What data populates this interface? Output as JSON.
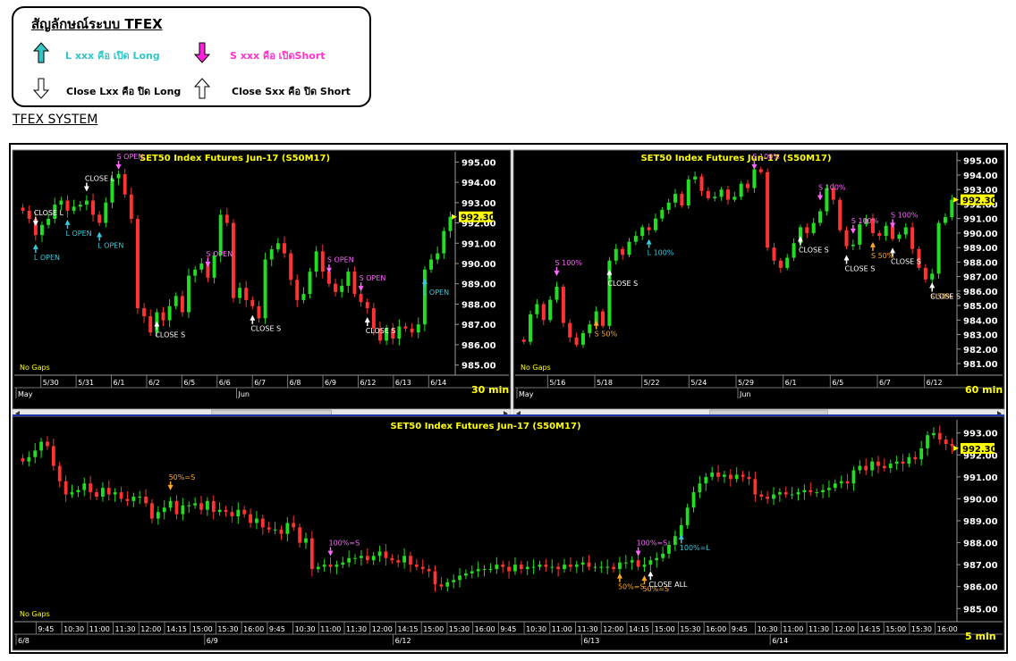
{
  "legend": {
    "title": "สัญลักษณ์ระบบ TFEX",
    "open_long": "L xxx คือ เปิด Long",
    "open_short": "S xxx คือ เปิดShort",
    "close_long": "Close Lxx คือ ปิด Long",
    "close_short": "Close Sxx คือ ปิด Short",
    "colors": {
      "long": "#33c6c6",
      "short": "#ff33cc",
      "close": "#ffffff"
    }
  },
  "system_title": "TFEX SYSTEM",
  "colors": {
    "up": "#22dd22",
    "down": "#ff3333",
    "bg": "#000000",
    "price_box": "#ffff00",
    "title": "#ffff00",
    "signal_cyan": "#33ccdd",
    "signal_magenta": "#ff66ff",
    "signal_orange": "#ffaa22"
  },
  "chart_data": [
    {
      "type": "candlestick",
      "title": "SET50  Index  Futures  Jun-17  (S50M17)",
      "timeframe": "30  min",
      "no_gaps": "No  Gaps",
      "last_price": "992.30",
      "y_ticks": [
        "995.00",
        "994.00",
        "993.00",
        "992.00",
        "991.00",
        "990.00",
        "989.00",
        "988.00",
        "987.00",
        "986.00",
        "985.00"
      ],
      "ylim": [
        984.5,
        995.5
      ],
      "x_ticks": [
        "5/30",
        "5/31",
        "6/1",
        "6/2",
        "6/5",
        "6/6",
        "6/7",
        "6/8",
        "6/9",
        "6/12",
        "6/13",
        "6/14"
      ],
      "months": [
        "May",
        "Jun"
      ],
      "closes": [
        992.6,
        992.2,
        991.4,
        991.9,
        992.2,
        992.9,
        993.1,
        992.6,
        992.8,
        992.9,
        993.1,
        992.4,
        992.0,
        993.0,
        994.2,
        994.4,
        993.4,
        992.2,
        987.8,
        987.4,
        986.6,
        987.6,
        987.2,
        987.9,
        988.4,
        987.6,
        989.4,
        989.7,
        990.0,
        989.3,
        990.4,
        992.4,
        992.0,
        988.3,
        988.8,
        988.2,
        987.9,
        987.3,
        990.2,
        990.7,
        991.0,
        990.5,
        989.2,
        988.2,
        988.5,
        989.6,
        990.6,
        989.6,
        989.0,
        988.6,
        988.9,
        989.6,
        988.5,
        988.1,
        987.8,
        986.8,
        986.2,
        986.8,
        986.3,
        986.9,
        986.8,
        986.6,
        987.0,
        989.7,
        990.2,
        990.5,
        991.6,
        992.3
      ],
      "signals": [
        {
          "label": "L  OPEN",
          "kind": "L",
          "type": "up"
        },
        {
          "label": "CLOSE  L",
          "kind": "C",
          "type": "down"
        },
        {
          "label": "L  OPEN",
          "kind": "L",
          "type": "up"
        },
        {
          "label": "CLOSE  L",
          "kind": "C",
          "type": "down"
        },
        {
          "label": "L  OPEN",
          "kind": "L",
          "type": "up"
        },
        {
          "label": "S  OPEN",
          "kind": "S",
          "type": "down"
        },
        {
          "label": "CLOSE  S",
          "kind": "C",
          "type": "up"
        },
        {
          "label": "S  OPEN",
          "kind": "S",
          "type": "down"
        },
        {
          "label": "CLOSE  S",
          "kind": "C",
          "type": "up"
        },
        {
          "label": "S  OPEN",
          "kind": "S",
          "type": "down"
        },
        {
          "label": "CLOSE  S",
          "kind": "C",
          "type": "up"
        },
        {
          "label": "S  OPEN",
          "kind": "S",
          "type": "down"
        },
        {
          "label": "L  OPEN",
          "kind": "L",
          "type": "up"
        }
      ]
    },
    {
      "type": "candlestick",
      "title": "SET50  Index  Futures  Jun-17  (S50M17)",
      "timeframe": "60  min",
      "no_gaps": "No  Gaps",
      "last_price": "992.30",
      "y_ticks": [
        "995.00",
        "994.00",
        "993.00",
        "992.00",
        "991.00",
        "990.00",
        "989.00",
        "988.00",
        "987.00",
        "986.00",
        "985.00",
        "984.00",
        "983.00",
        "982.00",
        "981.00"
      ],
      "ylim": [
        980.2,
        995.6
      ],
      "x_ticks": [
        "5/16",
        "5/18",
        "5/22",
        "5/24",
        "5/29",
        "6/1",
        "6/5",
        "6/7",
        "6/12"
      ],
      "months": [
        "May",
        "Jun"
      ],
      "closes": [
        982.5,
        984.4,
        985.1,
        984.0,
        985.4,
        986.3,
        983.8,
        982.8,
        982.3,
        983.1,
        983.7,
        984.6,
        983.6,
        988.1,
        988.9,
        988.5,
        989.4,
        989.8,
        990.4,
        990.2,
        991.0,
        991.6,
        992.1,
        992.7,
        991.9,
        993.7,
        993.9,
        992.9,
        992.4,
        992.5,
        993.0,
        992.3,
        992.5,
        993.4,
        993.1,
        994.4,
        994.2,
        989.0,
        988.1,
        987.6,
        988.3,
        989.3,
        990.4,
        990.0,
        990.7,
        991.5,
        993.1,
        992.3,
        990.2,
        989.1,
        989.2,
        990.6,
        991.0,
        990.0,
        989.8,
        990.5,
        989.6,
        989.9,
        990.4,
        988.9,
        987.6,
        986.8,
        987.2,
        990.7,
        991.1,
        992.3
      ],
      "signals": [
        {
          "label": "S  100%",
          "kind": "S",
          "type": "down"
        },
        {
          "label": "S  50%",
          "kind": "H",
          "type": "up"
        },
        {
          "label": "CLOSE  S",
          "kind": "C",
          "type": "up"
        },
        {
          "label": "L  100%",
          "kind": "L",
          "type": "up"
        },
        {
          "label": "S  100%",
          "kind": "S",
          "type": "down"
        },
        {
          "label": "CLOSE  S",
          "kind": "C",
          "type": "up"
        },
        {
          "label": "S  100%",
          "kind": "S",
          "type": "down"
        },
        {
          "label": "CLOSE  S",
          "kind": "C",
          "type": "up"
        },
        {
          "label": "S  100%",
          "kind": "S",
          "type": "down"
        },
        {
          "label": "S  50%",
          "kind": "H",
          "type": "up"
        },
        {
          "label": "CLOSE  S",
          "kind": "C",
          "type": "up"
        },
        {
          "label": "S  100%",
          "kind": "S",
          "type": "down"
        },
        {
          "label": "S  50%",
          "kind": "H",
          "type": "up"
        },
        {
          "label": "CLOSE  S",
          "kind": "C",
          "type": "up"
        }
      ]
    },
    {
      "type": "candlestick",
      "title": "SET50  Index  Futures  Jun-17  (S50M17)",
      "timeframe": "5  min",
      "no_gaps": "No  Gaps",
      "last_price": "992.30",
      "y_ticks": [
        "993.00",
        "992.00",
        "991.00",
        "990.00",
        "989.00",
        "988.00",
        "987.00",
        "986.00",
        "985.00"
      ],
      "ylim": [
        984.4,
        993.6
      ],
      "x_ticks": [
        "9:45",
        "10:30",
        "11:00",
        "11:30",
        "12:00",
        "14:15",
        "15:00",
        "15:30",
        "16:00",
        "9:45",
        "10:30",
        "11:00",
        "11:30",
        "12:00",
        "14:15",
        "15:00",
        "15:30",
        "16:00",
        "9:45",
        "10:30",
        "11:00",
        "11:30",
        "12:00",
        "14:15",
        "15:00",
        "15:30",
        "16:00",
        "9:45",
        "10:30",
        "11:00",
        "11:30",
        "12:00",
        "14:15",
        "15:00",
        "15:30",
        "16:00"
      ],
      "dates": [
        "6/8",
        "6/9",
        "6/12",
        "6/13",
        "6/14"
      ],
      "closes": [
        991.7,
        991.9,
        992.2,
        992.6,
        992.4,
        991.5,
        990.8,
        990.2,
        990.3,
        990.4,
        990.7,
        990.3,
        990.1,
        990.5,
        990.2,
        990.3,
        990.0,
        989.9,
        990.1,
        990.1,
        989.8,
        989.1,
        989.4,
        989.6,
        989.9,
        989.3,
        989.7,
        989.7,
        989.8,
        989.5,
        989.9,
        989.4,
        989.5,
        989.4,
        989.2,
        989.5,
        989.3,
        988.9,
        989.1,
        988.7,
        988.6,
        988.6,
        988.4,
        988.9,
        988.7,
        988.0,
        988.2,
        986.8,
        986.9,
        987.0,
        986.9,
        987.0,
        987.1,
        987.3,
        987.3,
        987.4,
        987.2,
        987.4,
        987.6,
        987.3,
        987.2,
        987.1,
        987.4,
        987.0,
        986.9,
        986.8,
        986.7,
        986.1,
        986.0,
        986.2,
        986.3,
        986.5,
        986.6,
        986.7,
        986.8,
        986.8,
        986.8,
        987.0,
        986.9,
        986.7,
        987.0,
        986.8,
        986.9,
        986.9,
        987.0,
        986.9,
        986.9,
        986.8,
        987.0,
        986.9,
        987.0,
        987.1,
        986.9,
        986.9,
        986.9,
        986.9,
        986.8,
        987.1,
        987.1,
        987.2,
        986.9,
        987.0,
        987.2,
        987.3,
        987.5,
        987.9,
        988.3,
        988.8,
        989.6,
        990.3,
        990.7,
        991.0,
        991.2,
        991.0,
        991.1,
        990.9,
        991.1,
        991.0,
        990.9,
        990.2,
        990.1,
        990.0,
        990.2,
        990.3,
        990.2,
        990.2,
        990.3,
        990.4,
        990.3,
        990.3,
        990.4,
        990.5,
        990.7,
        990.8,
        990.7,
        991.3,
        991.5,
        991.3,
        991.7,
        991.5,
        991.4,
        991.6,
        991.7,
        991.6,
        991.9,
        991.8,
        992.3,
        992.9,
        993.0,
        992.7,
        992.5,
        992.4
      ],
      "signals": [
        {
          "label": "50%=S",
          "kind": "H",
          "type": "down"
        },
        {
          "label": "100%=S",
          "kind": "S",
          "type": "down"
        },
        {
          "label": "50%=S",
          "kind": "H",
          "type": "up"
        },
        {
          "label": "50%=S",
          "kind": "H",
          "type": "up"
        },
        {
          "label": "100%=S",
          "kind": "S",
          "type": "down"
        },
        {
          "label": "CLOSE  ALL",
          "kind": "C",
          "type": "up"
        },
        {
          "label": "100%=L",
          "kind": "L",
          "type": "up"
        }
      ]
    }
  ]
}
